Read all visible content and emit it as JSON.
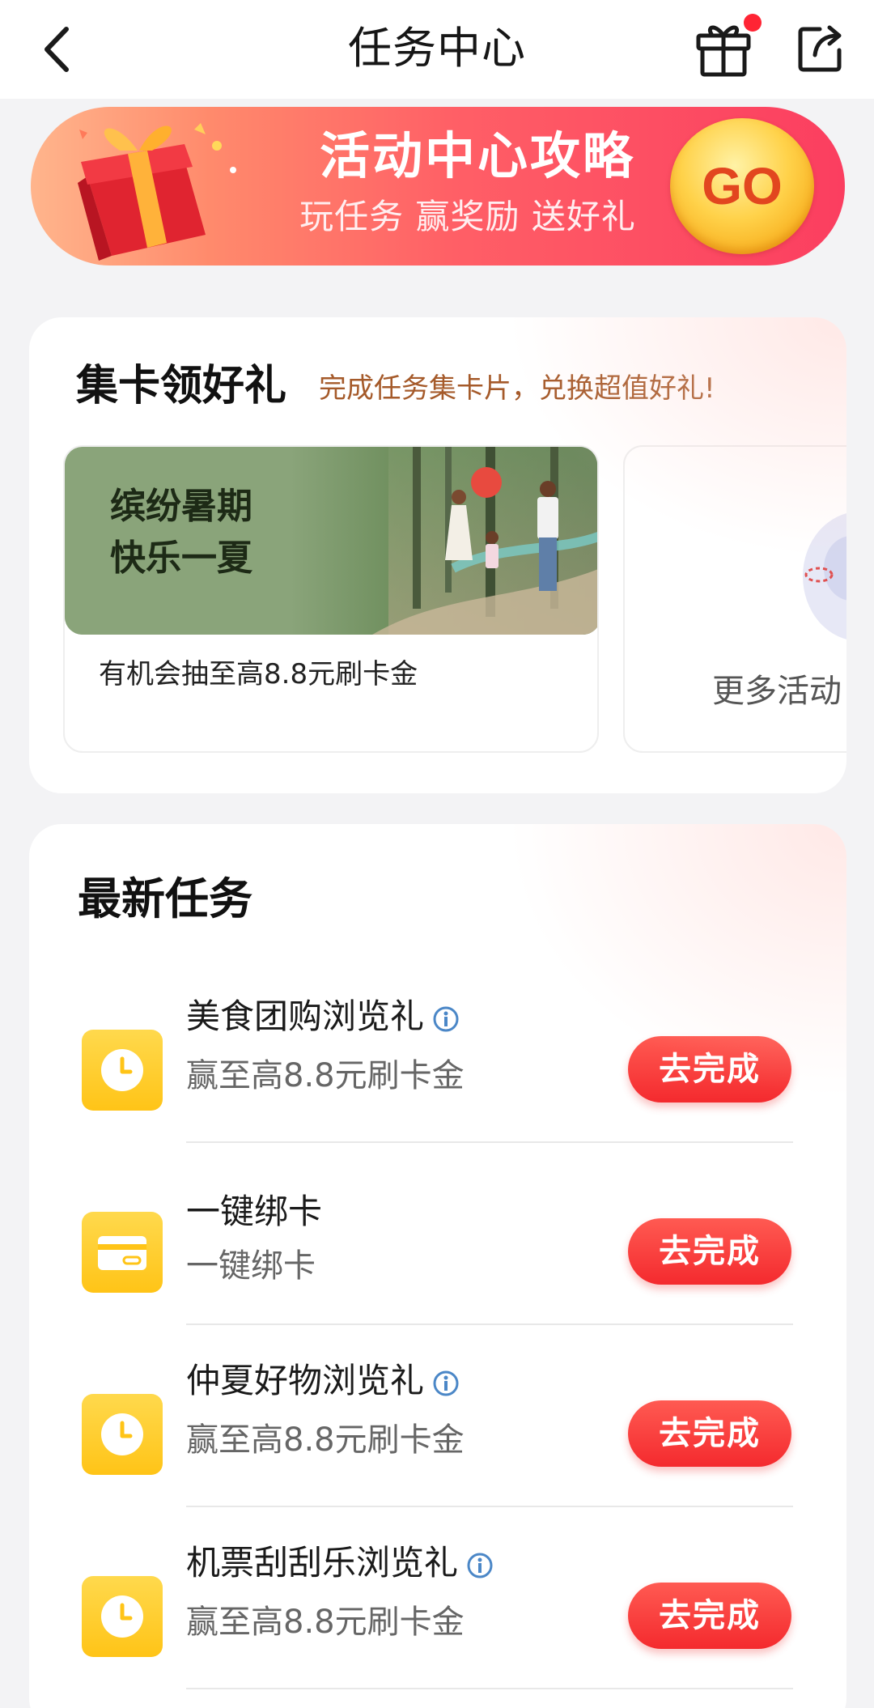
{
  "header": {
    "title": "任务中心",
    "has_notification_dot": true
  },
  "banner": {
    "title": "活动中心攻略",
    "subtitle": "玩任务 赢奖励 送好礼",
    "go_label": "GO",
    "colors": {
      "start": "#ffb58c",
      "end": "#fb3e60",
      "go": "#ffd24a"
    }
  },
  "cards_section": {
    "title": "集卡领好礼",
    "description": "完成任务集卡片，兑换超值好礼!",
    "promo": {
      "image_title_line1": "缤纷暑期",
      "image_title_line2": "快乐一夏",
      "description": "有机会抽至高8.8元刷卡金"
    },
    "more": {
      "label": "更多活动"
    }
  },
  "tasks_section": {
    "title": "最新任务",
    "tasks": [
      {
        "name": "美食团购浏览礼",
        "subtitle": "赢至高8.8元刷卡金",
        "button": "去完成",
        "icon": "clock-icon",
        "has_info": true
      },
      {
        "name": "一键绑卡",
        "subtitle": "一键绑卡",
        "button": "去完成",
        "icon": "card-icon",
        "has_info": false
      },
      {
        "name": "仲夏好物浏览礼",
        "subtitle": "赢至高8.8元刷卡金",
        "button": "去完成",
        "icon": "clock-icon",
        "has_info": true
      },
      {
        "name": "机票刮刮乐浏览礼",
        "subtitle": "赢至高8.8元刷卡金",
        "button": "去完成",
        "icon": "clock-icon",
        "has_info": true
      }
    ]
  },
  "colors": {
    "accent_red": "#f42a2e",
    "icon_yellow": "#ffc417",
    "link_brown": "#a55a2a"
  }
}
